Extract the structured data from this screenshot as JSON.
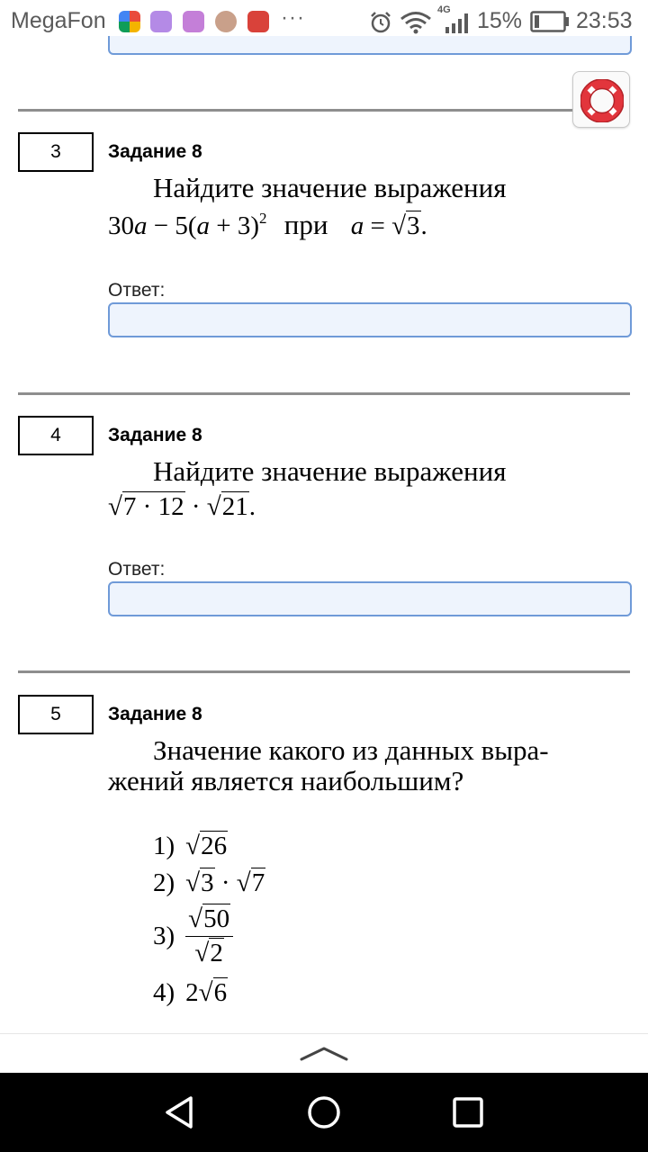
{
  "status_bar": {
    "carrier": "MegaFon",
    "network": "4G",
    "battery": "15%",
    "time": "23:53",
    "more": "···"
  },
  "tasks": [
    {
      "number": "3",
      "title": "Задание 8",
      "text_line1": "Найдите значение выражения",
      "word_at": "при",
      "answer_label": "Ответ:"
    },
    {
      "number": "4",
      "title": "Задание 8",
      "text_line1": "Найдите значение выражения",
      "answer_label": "Ответ:"
    },
    {
      "number": "5",
      "title": "Задание 8",
      "text_line1": "Значение какого из данных выра-",
      "text_line2": "жений является наибольшим?",
      "options": [
        "1)",
        "2)",
        "3)",
        "4)"
      ]
    }
  ],
  "math": {
    "t3_a": "30",
    "t3_b": "a",
    "t3_c": " − 5(",
    "t3_d": "a",
    "t3_e": " + 3)",
    "t3_exp": "2",
    "t3_f": "a",
    "t3_g": " = ",
    "t3_h": "3",
    "t3_i": ".",
    "t4_rad1": "7 · 12",
    "t4_dot": " · ",
    "t4_rad2": "21",
    "t4_end": ".",
    "o1_rad": "26",
    "o2_rad1": "3",
    "o2_dot": " · ",
    "o2_rad2": "7",
    "o3_num": "50",
    "o3_den": "2",
    "o4_coef": "2",
    "o4_rad": "6",
    "sqrt": "√"
  },
  "icons": {
    "help": "lifebuoy-icon",
    "scroll_up": "chevron-up-icon",
    "nav_back": "triangle-back-icon",
    "nav_home": "circle-home-icon",
    "nav_recent": "square-recent-icon"
  },
  "colors": {
    "input_border": "#6f9ad8",
    "input_fill": "#eef4fd",
    "lifebuoy_red": "#e2353c"
  }
}
